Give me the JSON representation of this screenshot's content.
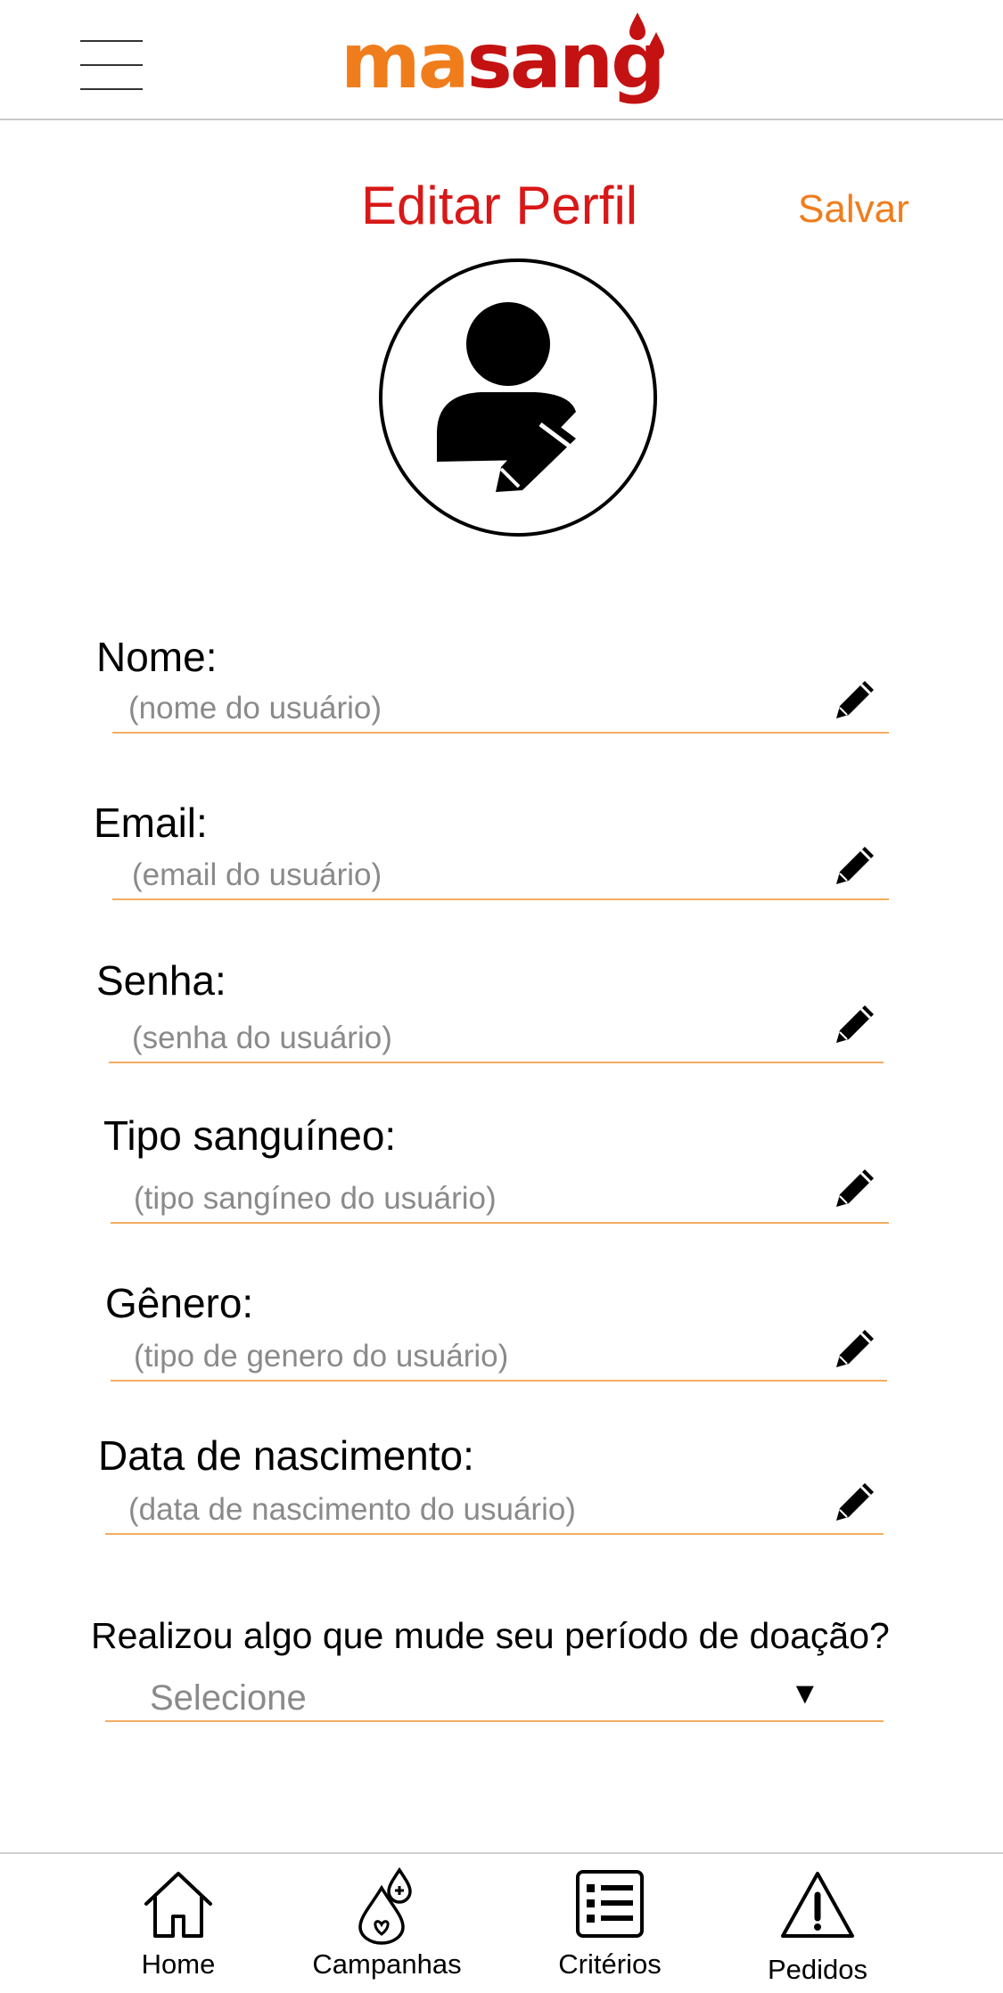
{
  "header": {
    "logo_part1": "ma",
    "logo_part2": "sang"
  },
  "page": {
    "title": "Editar Perfil",
    "save_label": "Salvar"
  },
  "fields": [
    {
      "label": "Nome:",
      "placeholder": "(nome do usuário)"
    },
    {
      "label": "Email:",
      "placeholder": "(email do usuário)"
    },
    {
      "label": "Senha:",
      "placeholder": "(senha do usuário)"
    },
    {
      "label": "Tipo sanguíneo:",
      "placeholder": "(tipo sangíneo do usuário)"
    },
    {
      "label": "Gênero:",
      "placeholder": "(tipo de genero do usuário)"
    },
    {
      "label": "Data de nascimento:",
      "placeholder": "(data de nascimento do usuário)"
    }
  ],
  "donation_question": {
    "label": "Realizou algo que mude seu período de doação?",
    "selected": "Selecione",
    "arrow": "▼"
  },
  "bottom_nav": [
    {
      "label": "Home",
      "icon": "home-icon"
    },
    {
      "label": "Campanhas",
      "icon": "blood-drop-icon"
    },
    {
      "label": "Critérios",
      "icon": "list-icon"
    },
    {
      "label": "Pedidos",
      "icon": "warning-icon"
    }
  ],
  "colors": {
    "brand_orange": "#f07d1c",
    "brand_red": "#c41212",
    "title_red": "#d81818",
    "underline": "#f3ad62",
    "placeholder_gray": "#8a8a8a"
  }
}
